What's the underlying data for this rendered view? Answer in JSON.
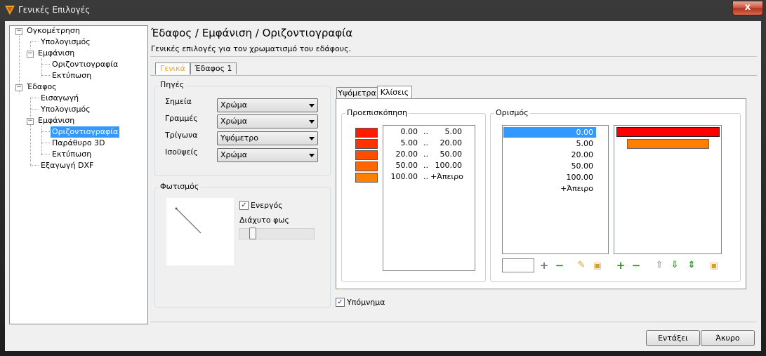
{
  "window": {
    "title": "Γενικές Επιλογές",
    "close": "x"
  },
  "tree": {
    "n0": "Ογκομέτρηση",
    "n1": "Υπολογισμός",
    "n2": "Εμφάνιση",
    "n3": "Οριζοντιογραφία",
    "n4": "Εκτύπωση",
    "n5": "Έδαφος",
    "n6": "Εισαγωγή",
    "n7": "Υπολογισμός",
    "n8": "Εμφάνιση",
    "n9": "Οριζοντιογραφία",
    "n10": "Παράθυρο 3D",
    "n11": "Εκτύπωση",
    "n12": "Εξαγωγή DXF"
  },
  "page": {
    "title": "Έδαφος / Εμφάνιση / Οριζοντιογραφία",
    "subtitle": "Γενικές επιλογές για τον χρωματισμό του εδάφους."
  },
  "tabs": {
    "general": "Γενικά",
    "ground1": "Έδαφος 1"
  },
  "sources": {
    "title": "Πηγές",
    "points_label": "Σημεία",
    "points_value": "Χρώμα",
    "lines_label": "Γραμμές",
    "lines_value": "Χρώμα",
    "triangles_label": "Τρίγωνα",
    "triangles_value": "Υψόμετρο",
    "contours_label": "Ισοϋψείς",
    "contours_value": "Χρώμα"
  },
  "lighting": {
    "title": "Φωτισμός",
    "active_label": "Ενεργός",
    "active_checked": "✓",
    "diffuse_label": "Διάχυτο φως",
    "diffuse_level": 0.15
  },
  "subtabs": {
    "elevations": "Υψόμετρα",
    "classes": "Κλίσεις"
  },
  "preview": {
    "title": "Προεπισκόπηση",
    "rows": [
      {
        "from": "0.00",
        "sep": "..",
        "to": "5.00",
        "color": "#ff1a00"
      },
      {
        "from": "5.00",
        "sep": "..",
        "to": "20.00",
        "color": "#ff3300"
      },
      {
        "from": "20.00",
        "sep": "..",
        "to": "50.00",
        "color": "#ff4d00"
      },
      {
        "from": "50.00",
        "sep": "..",
        "to": "100.00",
        "color": "#ff6600"
      },
      {
        "from": "100.00",
        "sep": "..",
        "to": "+Άπειρο",
        "color": "#ff8000"
      }
    ]
  },
  "definition": {
    "title": "Ορισμός",
    "values": [
      "0.00",
      "5.00",
      "20.00",
      "50.00",
      "100.00",
      "+Άπειρο"
    ],
    "input_value": "",
    "colors": [
      "#ff0000",
      "#ff8000"
    ]
  },
  "legend": {
    "label": "Υπόμνημα",
    "checked": "✓"
  },
  "buttons": {
    "ok": "Εντάξει",
    "cancel": "Άκυρο"
  }
}
